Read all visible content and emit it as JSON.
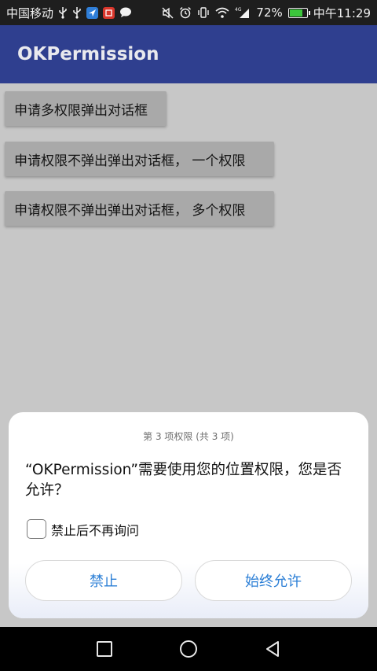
{
  "status_bar": {
    "carrier": "中国移动",
    "battery_percent": "72%",
    "battery_level": 0.72,
    "network": "4G",
    "time": "中午11:29"
  },
  "app_bar": {
    "title": "OKPermission"
  },
  "buttons": [
    {
      "label": "申请多权限弹出对话框"
    },
    {
      "label": "申请权限不弹出弹出对话框， 一个权限"
    },
    {
      "label": "申请权限不弹出弹出对话框， 多个权限"
    }
  ],
  "dialog": {
    "subtitle": "第 3 项权限 (共 3 项)",
    "message": "“OKPermission”需要使用您的位置权限，您是否允许？",
    "dont_ask_label": "禁止后不再询问",
    "dont_ask_checked": false,
    "deny_label": "禁止",
    "allow_label": "始终允许"
  },
  "colors": {
    "app_bar": "#2f3f8f",
    "dialog_button_text": "#2c7fd6",
    "battery_fill": "#3cc63c"
  },
  "icons": {
    "status": [
      "usb-icon",
      "usb-icon",
      "navigation-app-icon",
      "notification-app-icon",
      "chat-icon",
      "mute-icon",
      "alarm-icon",
      "vibrate-icon",
      "wifi-icon",
      "signal-icon",
      "battery-icon"
    ],
    "nav": [
      "recents-icon",
      "home-icon",
      "back-icon"
    ]
  }
}
